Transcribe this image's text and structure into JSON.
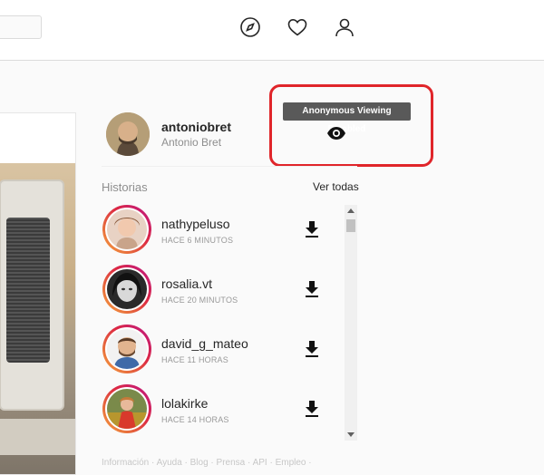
{
  "header": {
    "icons": [
      "compass-icon",
      "heart-icon",
      "user-icon"
    ]
  },
  "profile": {
    "username": "antoniobret",
    "full_name": "Antonio Bret"
  },
  "anonymous_viewing": {
    "tooltip": "Anonymous Viewing Disabled",
    "icon": "eye-icon",
    "highlight_color": "#e0252a"
  },
  "stories": {
    "title": "Historias",
    "see_all": "Ver todas",
    "items": [
      {
        "username": "nathypeluso",
        "time": "HACE 6 MINUTOS"
      },
      {
        "username": "rosalia.vt",
        "time": "HACE 20 MINUTOS"
      },
      {
        "username": "david_g_mateo",
        "time": "HACE 11 HORAS"
      },
      {
        "username": "lolakirke",
        "time": "HACE 14 HORAS"
      }
    ]
  },
  "footer": {
    "links": "Información · Ayuda · Blog · Prensa · API · Empleo ·"
  },
  "colors": {
    "story_ring_start": "#f9a33e",
    "story_ring_end": "#bc1888",
    "background": "#fafafa"
  }
}
